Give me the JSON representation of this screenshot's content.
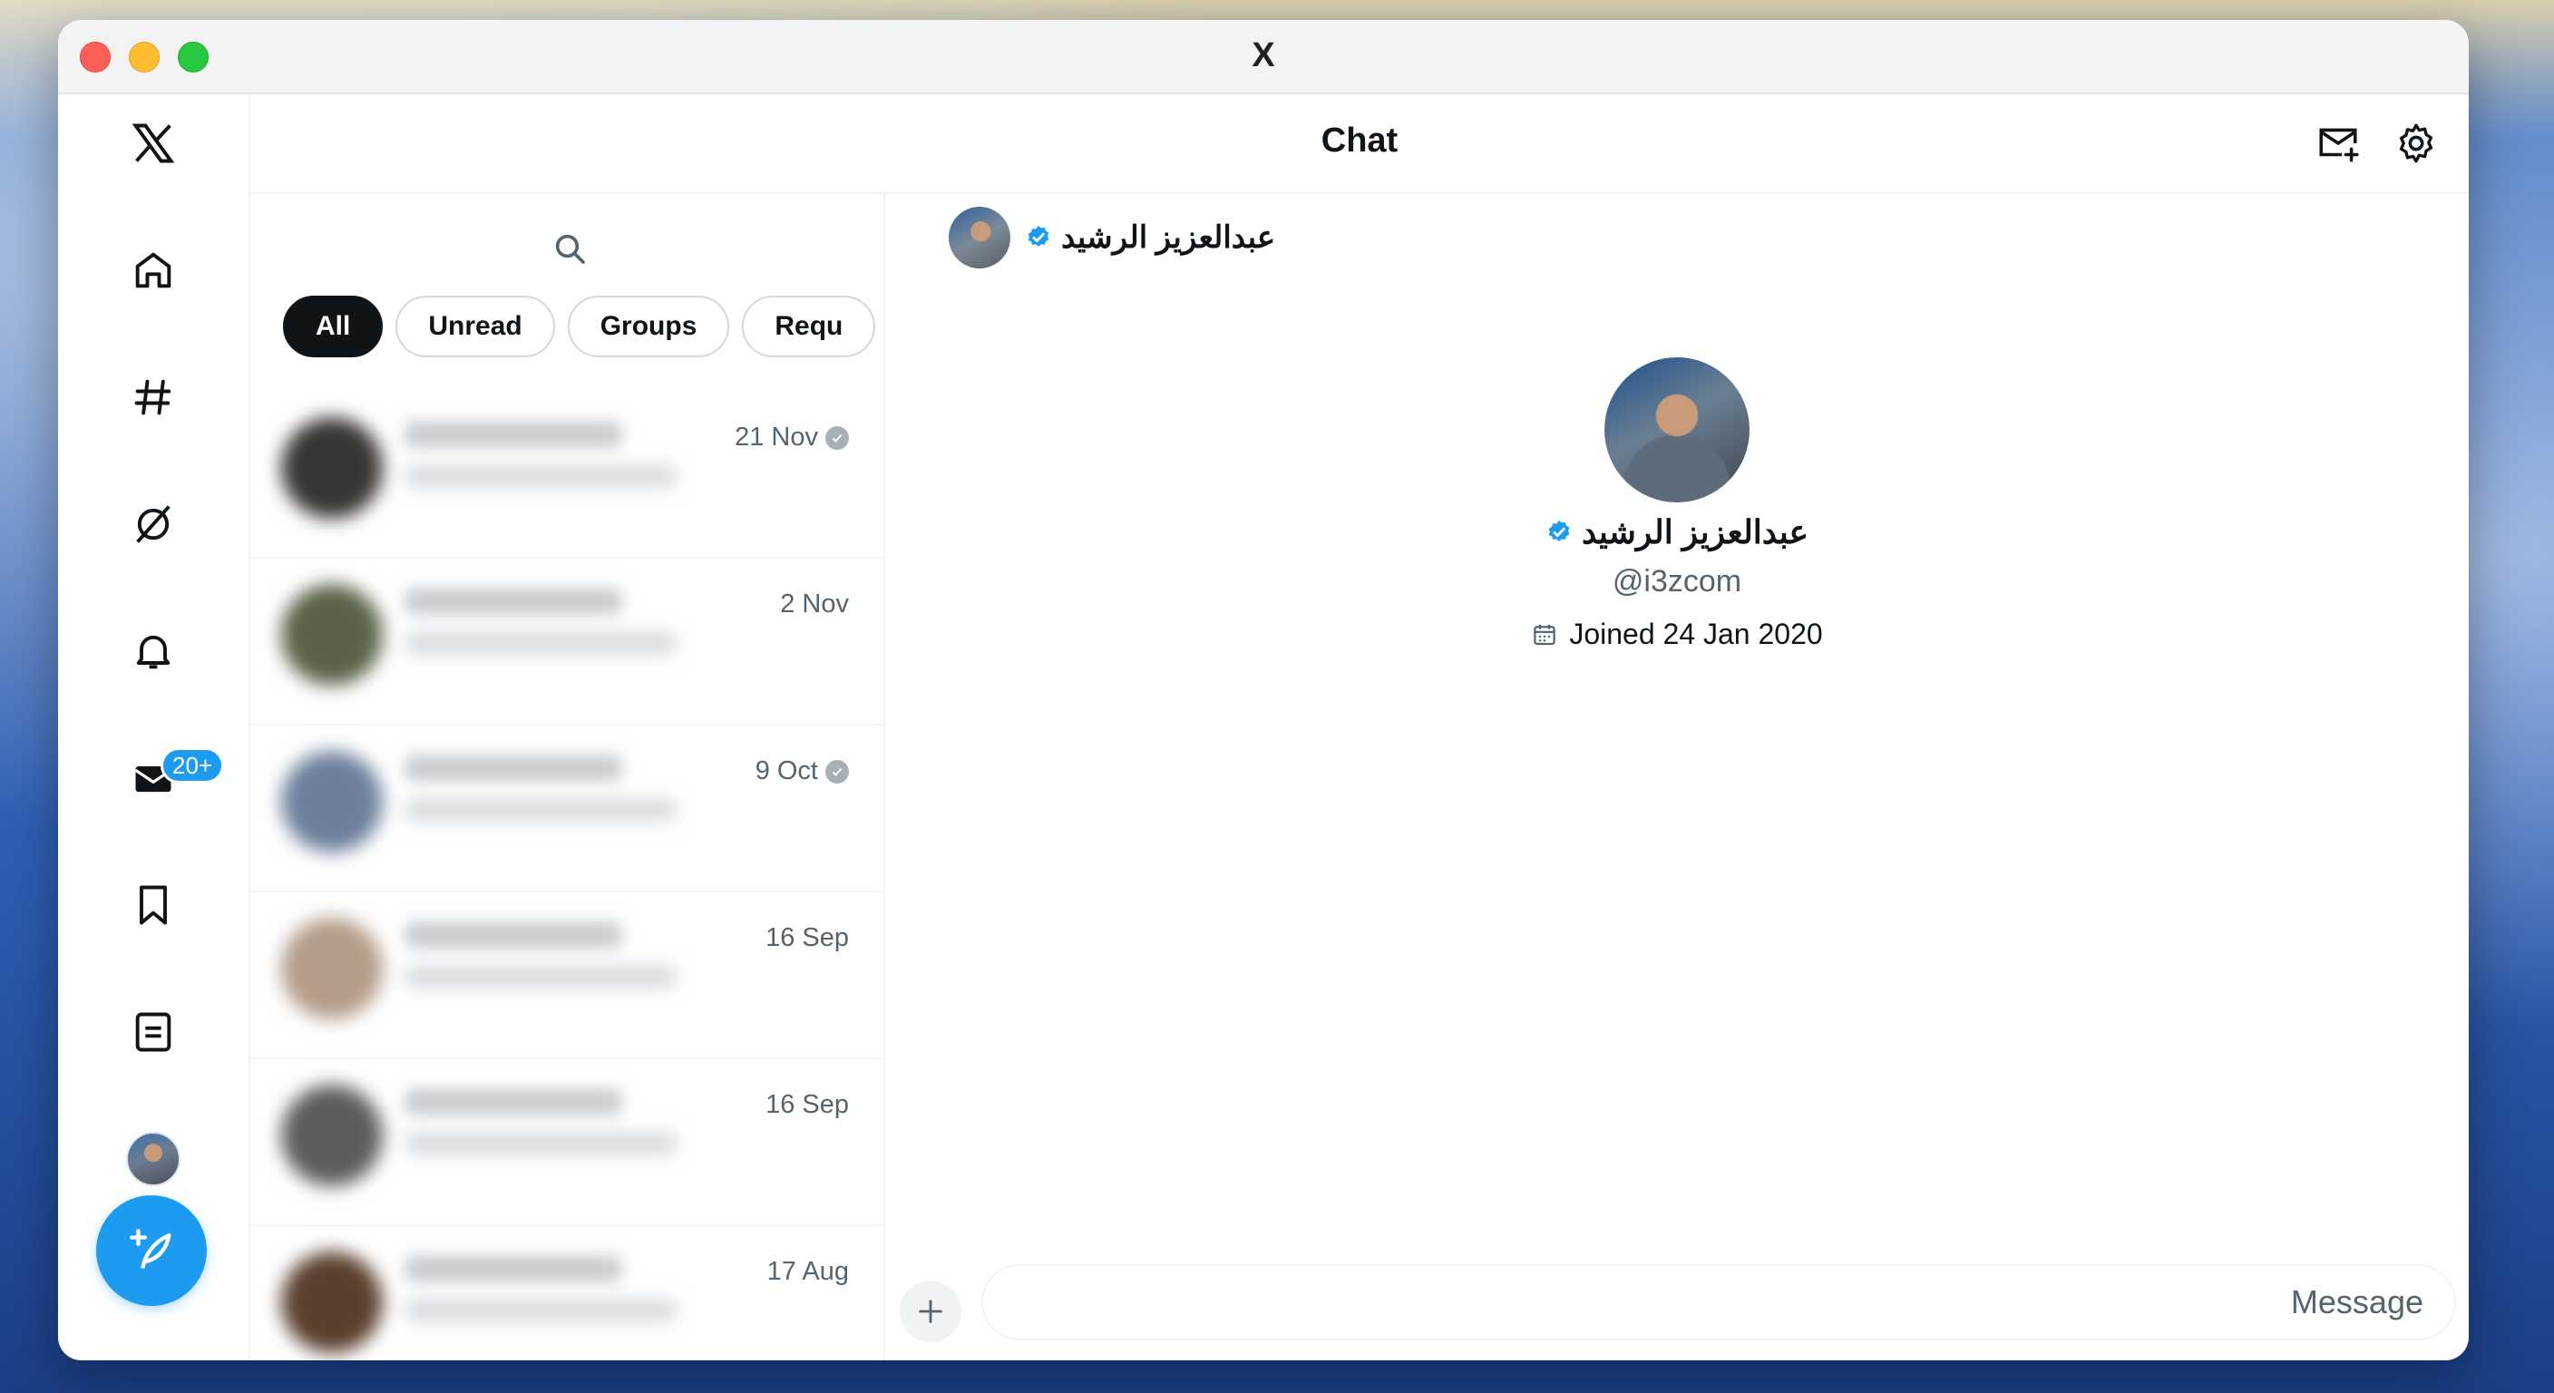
{
  "window": {
    "title": "X"
  },
  "header": {
    "title": "Chat"
  },
  "nav": {
    "items": [
      "x-logo",
      "home-icon",
      "explore-hashtag-icon",
      "grok-icon",
      "notifications-bell-icon",
      "messages-icon",
      "bookmark-icon",
      "lists-icon",
      "profile-avatar"
    ],
    "messages_badge": "20+"
  },
  "filters": [
    {
      "label": "All",
      "active": true
    },
    {
      "label": "Unread",
      "active": false
    },
    {
      "label": "Groups",
      "active": false
    },
    {
      "label": "Requ",
      "active": false
    }
  ],
  "conversations": [
    {
      "date": "21 Nov",
      "read": true
    },
    {
      "date": "2 Nov",
      "read": false
    },
    {
      "date": "9 Oct",
      "read": true
    },
    {
      "date": "16 Sep",
      "read": false
    },
    {
      "date": "16 Sep",
      "read": false
    },
    {
      "date": "17 Aug",
      "read": false
    }
  ],
  "chat": {
    "name": "عبدالعزيز الرشيد",
    "handle": "@i3zcom",
    "joined": "Joined 24 Jan 2020",
    "message_placeholder": "Message"
  },
  "colors": {
    "accent": "#1d9bf0",
    "text": "#0f1419",
    "muted": "#536471"
  }
}
